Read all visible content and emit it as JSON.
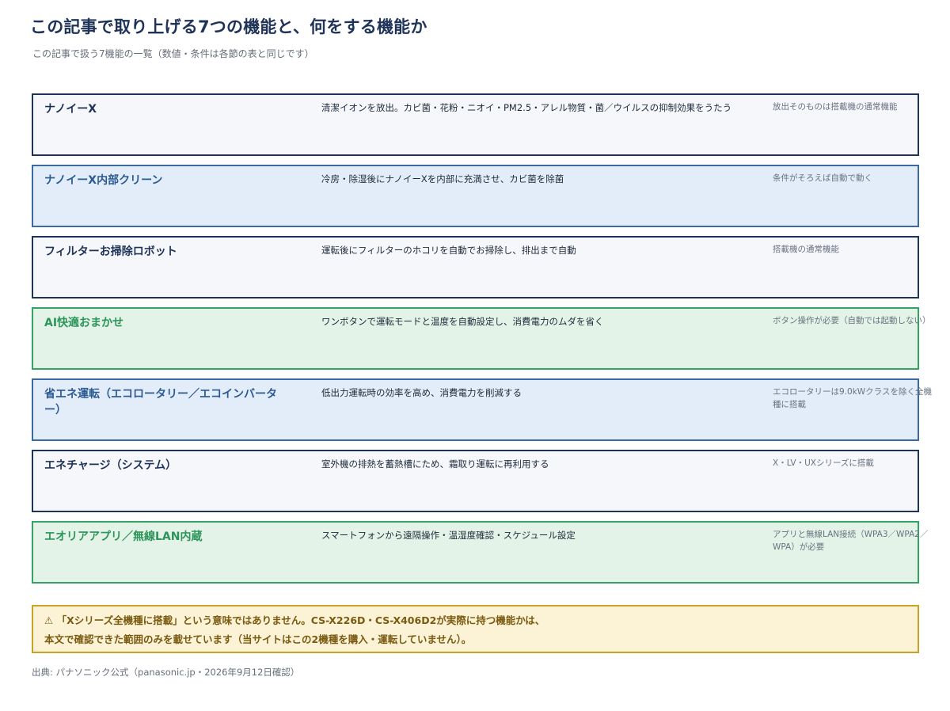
{
  "header": {
    "title": "この記事で取り上げる7つの機能と、何をする機能か",
    "subtitle": "この記事で扱う7機能の一覧（数値・条件は各節の表と同じです）"
  },
  "features": [
    {
      "name": "ナノイーX",
      "description": "清潔イオンを放出。カビ菌・花粉・ニオイ・PM2.5・アレル物質・菌／ウイルスの抑制効果をうたう",
      "note": "放出そのものは搭載機の通常機能",
      "style": "dark"
    },
    {
      "name": "ナノイーX内部クリーン",
      "description": "冷房・除湿後にナノイーXを内部に充満させ、カビ菌を除菌",
      "note": "条件がそろえば自動で動く",
      "style": "blue"
    },
    {
      "name": "フィルターお掃除ロボット",
      "description": "運転後にフィルターのホコリを自動でお掃除し、排出まで自動",
      "note": "搭載機の通常機能",
      "style": "dark"
    },
    {
      "name": "AI快適おまかせ",
      "description": "ワンボタンで運転モードと温度を自動設定し、消費電力のムダを省く",
      "note": "ボタン操作が必要（自動では起動しない）",
      "style": "green"
    },
    {
      "name": "省エネ運転（エコロータリー／エコインバーター）",
      "description": "低出力運転時の効率を高め、消費電力を削減する",
      "note": "エコロータリーは9.0kWクラスを除く全機種に搭載",
      "style": "blue"
    },
    {
      "name": "エネチャージ（システム）",
      "description": "室外機の排熱を蓄熱槽にため、霜取り運転に再利用する",
      "note": "X・LV・UXシリーズに搭載",
      "style": "dark"
    },
    {
      "name": "エオリアアプリ／無線LAN内蔵",
      "description": "スマートフォンから遠隔操作・温湿度確認・スケジュール設定",
      "note": "アプリと無線LAN接続（WPA3／WPA2／WPA）が必要",
      "style": "green"
    }
  ],
  "warning": {
    "icon": "warning-icon",
    "symbol": "⚠",
    "line1": "「Xシリーズ全機種に搭載」という意味ではありません。CS-X226D・CS-X406D2が実際に持つ機能かは、",
    "line2": "本文で確認できた範囲のみを載せています（当サイトはこの2機種を購入・運転していません）。"
  },
  "source": {
    "text": "出典: パナソニック公式（panasonic.jp・2026年9月12日確認）"
  }
}
